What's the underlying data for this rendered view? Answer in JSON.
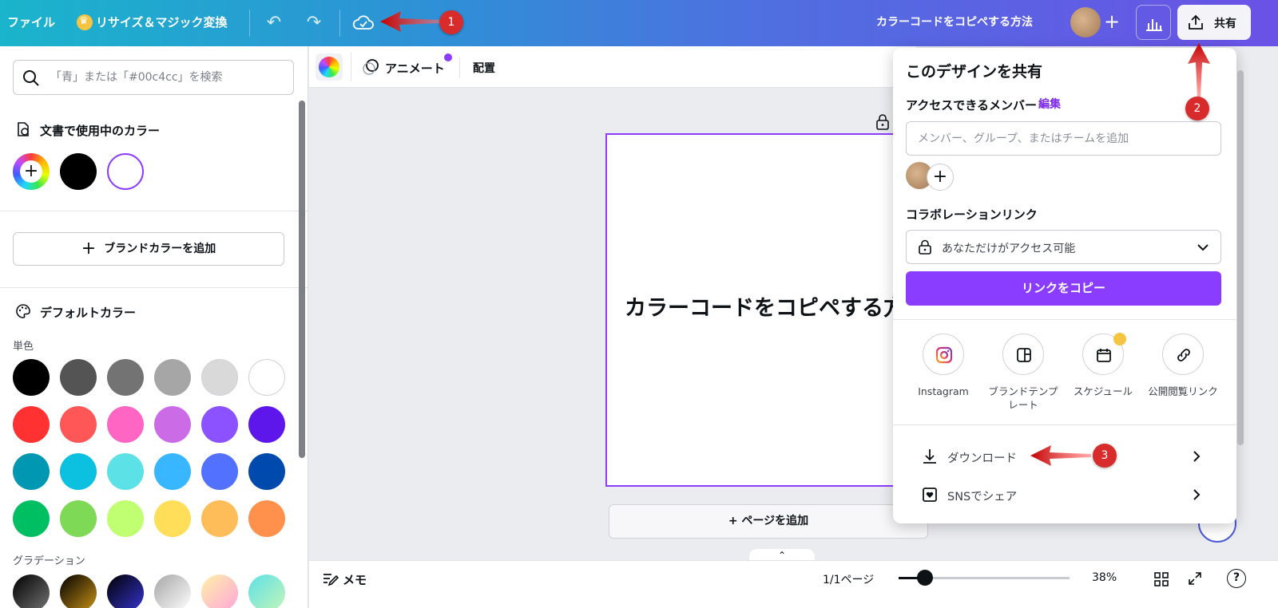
{
  "topbar": {
    "file_menu": "ファイル",
    "resize_magic": "リサイズ＆マジック変換",
    "document_title": "カラーコードをコピペする方法",
    "share_label": "共有"
  },
  "left_panel": {
    "search_placeholder": "「青」または「#00c4cc」を検索",
    "doc_colors_title": "文書で使用中のカラー",
    "doc_colors": [
      "#000000",
      "#ffffff"
    ],
    "brand_add_label": "ブランドカラーを追加",
    "default_colors_title": "デフォルトカラー",
    "solid_label": "単色",
    "solid_colors": [
      [
        "#000000",
        "#545454",
        "#737373",
        "#a6a6a6",
        "#d9d9d9",
        "#ffffff"
      ],
      [
        "#ff3131",
        "#ff5757",
        "#ff66c4",
        "#cb6ce6",
        "#8c52ff",
        "#5e17eb"
      ],
      [
        "#0097b2",
        "#0cc0df",
        "#5ce1e6",
        "#38b6ff",
        "#5271ff",
        "#004aad"
      ],
      [
        "#00bf63",
        "#7ed957",
        "#c1ff72",
        "#ffde59",
        "#ffbd59",
        "#ff914d"
      ]
    ],
    "gradient_label": "グラデーション"
  },
  "canvas_toolbar": {
    "animate_label": "アニメート",
    "position_label": "配置"
  },
  "canvas": {
    "page_text": "カラーコードをコピペする方法",
    "add_page_label": "+ ページを追加"
  },
  "bottom_bar": {
    "notes_label": "メモ",
    "page_indicator": "1/1ページ",
    "zoom_percent": 38,
    "zoom_label": "38%"
  },
  "share_popup": {
    "title": "このデザインを共有",
    "access_label": "アクセスできるメンバー",
    "edit_label": "編集",
    "member_placeholder": "メンバー、グループ、またはチームを追加",
    "collab_label": "コラボレーションリンク",
    "access_select_value": "あなただけがアクセス可能",
    "copy_link_label": "リンクをコピー",
    "options": [
      {
        "label": "Instagram",
        "icon": "instagram-icon"
      },
      {
        "label": "ブランドテンプ\nレート",
        "icon": "brand-template-icon"
      },
      {
        "label": "スケジュール",
        "icon": "calendar-icon"
      },
      {
        "label": "公開閲覧リンク",
        "icon": "link-icon"
      }
    ],
    "download_label": "ダウンロード",
    "sns_label": "SNSでシェア"
  },
  "annotations": [
    "1",
    "2",
    "3"
  ],
  "colors": {
    "accent_purple": "#8b3dff",
    "annotation_red": "#d82b2b"
  }
}
